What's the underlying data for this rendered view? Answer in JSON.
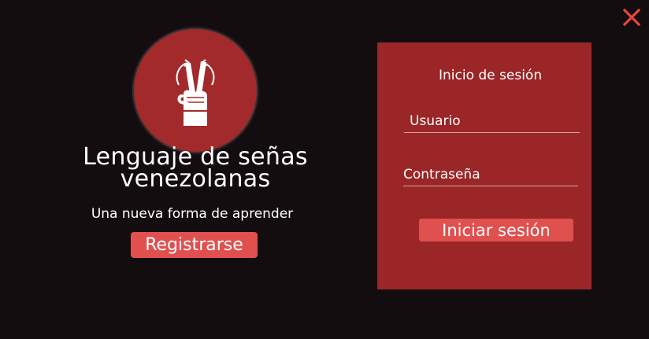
{
  "window": {
    "close_icon": "close-icon",
    "close_color": "#e8453c"
  },
  "intro": {
    "logo_icon": "peace-sign-hand-icon",
    "title_line1": "Lenguaje de señas",
    "title_line2": "venezolanas",
    "subtitle": "Una nueva forma de aprender",
    "register_label": "Registrarse"
  },
  "login": {
    "title": "Inicio de sesión",
    "username_placeholder": "Usuario",
    "password_placeholder": "Contraseña",
    "submit_label": "Iniciar sesión"
  },
  "colors": {
    "background": "#130d10",
    "panel": "#9b2627",
    "accent_button": "#e0504f",
    "logo_circle": "#a32a2a"
  }
}
